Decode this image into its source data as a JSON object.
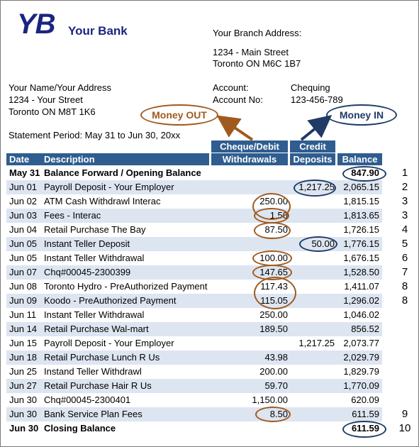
{
  "bank": {
    "logo": "YB",
    "name": "Your Bank"
  },
  "branch": {
    "label": "Your Branch Address:",
    "street": "1234 - Main Street",
    "city": "Toronto ON M6C 1B7"
  },
  "customer": {
    "name": "Your Name/Your Address",
    "street": "1234 - Your Street",
    "city": "Toronto ON M8T 1K6"
  },
  "account": {
    "account_label": "Account:",
    "account_value": "Chequing",
    "number_label": "Account No:",
    "number_value": "123-456-789"
  },
  "statement_period": "Statement Period: May 31 to Jun 30, 20xx",
  "callouts": {
    "money_out": "Money OUT",
    "money_in": "Money IN"
  },
  "table": {
    "headers": {
      "date": "Date",
      "description": "Description",
      "withdrawals_top": "Cheque/Debit",
      "withdrawals": "Withdrawals",
      "deposits_top": "Credit",
      "deposits": "Deposits",
      "balance": "Balance"
    },
    "rows": [
      {
        "date": "May 31",
        "description": "Balance Forward / Opening Balance",
        "withdrawal": "",
        "deposit": "",
        "balance": "847.90",
        "marker": "1"
      },
      {
        "date": "Jun 01",
        "description": "Payroll Deposit - Your Employer",
        "withdrawal": "",
        "deposit": "1,217.25",
        "balance": "2,065.15",
        "marker": "2"
      },
      {
        "date": "Jun 02",
        "description": "ATM Cash Withdrawl Interac",
        "withdrawal": "250.00",
        "deposit": "",
        "balance": "1,815.15",
        "marker": "3"
      },
      {
        "date": "Jun 03",
        "description": "Fees - Interac",
        "withdrawal": "1.50",
        "deposit": "",
        "balance": "1,813.65",
        "marker": "3"
      },
      {
        "date": "Jun 04",
        "description": "Retail Purchase The Bay",
        "withdrawal": "87.50",
        "deposit": "",
        "balance": "1,726.15",
        "marker": "4"
      },
      {
        "date": "Jun 05",
        "description": "Instant Teller Deposit",
        "withdrawal": "",
        "deposit": "50.00",
        "balance": "1,776.15",
        "marker": "5"
      },
      {
        "date": "Jun 05",
        "description": "Instant Teller Withdrawal",
        "withdrawal": "100.00",
        "deposit": "",
        "balance": "1,676.15",
        "marker": "6"
      },
      {
        "date": "Jun 07",
        "description": "Chq#00045-2300399",
        "withdrawal": "147.65",
        "deposit": "",
        "balance": "1,528.50",
        "marker": "7"
      },
      {
        "date": "Jun 08",
        "description": "Toronto Hydro - PreAuthorized Payment",
        "withdrawal": "117.43",
        "deposit": "",
        "balance": "1,411.07",
        "marker": "8"
      },
      {
        "date": "Jun 09",
        "description": "Koodo - PreAuthorized Payment",
        "withdrawal": "115.05",
        "deposit": "",
        "balance": "1,296.02",
        "marker": "8"
      },
      {
        "date": "Jun 11",
        "description": "Instant Teller Withdrawal",
        "withdrawal": "250.00",
        "deposit": "",
        "balance": "1,046.02",
        "marker": ""
      },
      {
        "date": "Jun 14",
        "description": "Retail Purchase Wal-mart",
        "withdrawal": "189.50",
        "deposit": "",
        "balance": "856.52",
        "marker": ""
      },
      {
        "date": "Jun 15",
        "description": "Payroll Deposit - Your Employer",
        "withdrawal": "",
        "deposit": "1,217.25",
        "balance": "2,073.77",
        "marker": ""
      },
      {
        "date": "Jun 18",
        "description": "Retail Purchase Lunch R Us",
        "withdrawal": "43.98",
        "deposit": "",
        "balance": "2,029.79",
        "marker": ""
      },
      {
        "date": "Jun 25",
        "description": "Instand Teller Withdrawl",
        "withdrawal": "200.00",
        "deposit": "",
        "balance": "1,829.79",
        "marker": ""
      },
      {
        "date": "Jun 27",
        "description": "Retail Purchase Hair R Us",
        "withdrawal": "59.70",
        "deposit": "",
        "balance": "1,770.09",
        "marker": ""
      },
      {
        "date": "Jun 30",
        "description": "Chq#00045-2300401",
        "withdrawal": "1,150.00",
        "deposit": "",
        "balance": "620.09",
        "marker": ""
      },
      {
        "date": "Jun 30",
        "description": "Bank Service Plan Fees",
        "withdrawal": "8.50",
        "deposit": "",
        "balance": "611.59",
        "marker": "9"
      },
      {
        "date": "Jun 30",
        "description": "Closing Balance",
        "withdrawal": "",
        "deposit": "",
        "balance": "611.59",
        "marker": "10"
      }
    ]
  },
  "colors": {
    "brand": "#1a2580",
    "header": "#2f5d8f",
    "row_alt": "#dde5f1",
    "money_out": "#a05a1e",
    "money_in": "#1f3b66"
  }
}
